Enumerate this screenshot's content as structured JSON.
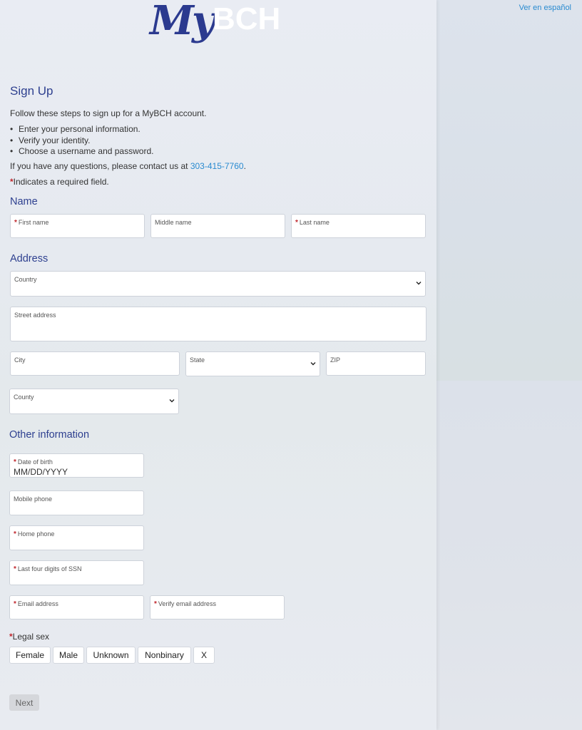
{
  "header": {
    "language_link": "Ver en español",
    "logo_my": "My",
    "logo_bch": "BCH"
  },
  "intro": {
    "title": "Sign Up",
    "lead": "Follow these steps to sign up for a MyBCH account.",
    "steps": [
      "Enter your personal information.",
      "Verify your identity.",
      "Choose a username and password."
    ],
    "contact_prefix": "If you have any questions, please contact us at ",
    "contact_phone": "303-415-7760",
    "contact_suffix": ".",
    "required_star": "*",
    "required_note": "Indicates a required field."
  },
  "name_section": {
    "heading": "Name",
    "first_name": "First name",
    "middle_name": "Middle name",
    "last_name": "Last name"
  },
  "address_section": {
    "heading": "Address",
    "country": "Country",
    "street": "Street address",
    "city": "City",
    "state": "State",
    "zip": "ZIP",
    "county": "County"
  },
  "other_section": {
    "heading": "Other information",
    "dob_label": "Date of birth",
    "dob_placeholder": "MM/DD/YYYY",
    "mobile_phone": "Mobile phone",
    "home_phone": "Home phone",
    "ssn": "Last four digits of SSN",
    "email": "Email address",
    "verify_email": "Verify email address",
    "legal_sex_label": "Legal sex",
    "legal_sex_options": [
      "Female",
      "Male",
      "Unknown",
      "Nonbinary",
      "X"
    ]
  },
  "actions": {
    "next": "Next"
  },
  "colors": {
    "heading": "#2d3f8f",
    "link": "#2a8bd0",
    "required": "#c0272d"
  }
}
